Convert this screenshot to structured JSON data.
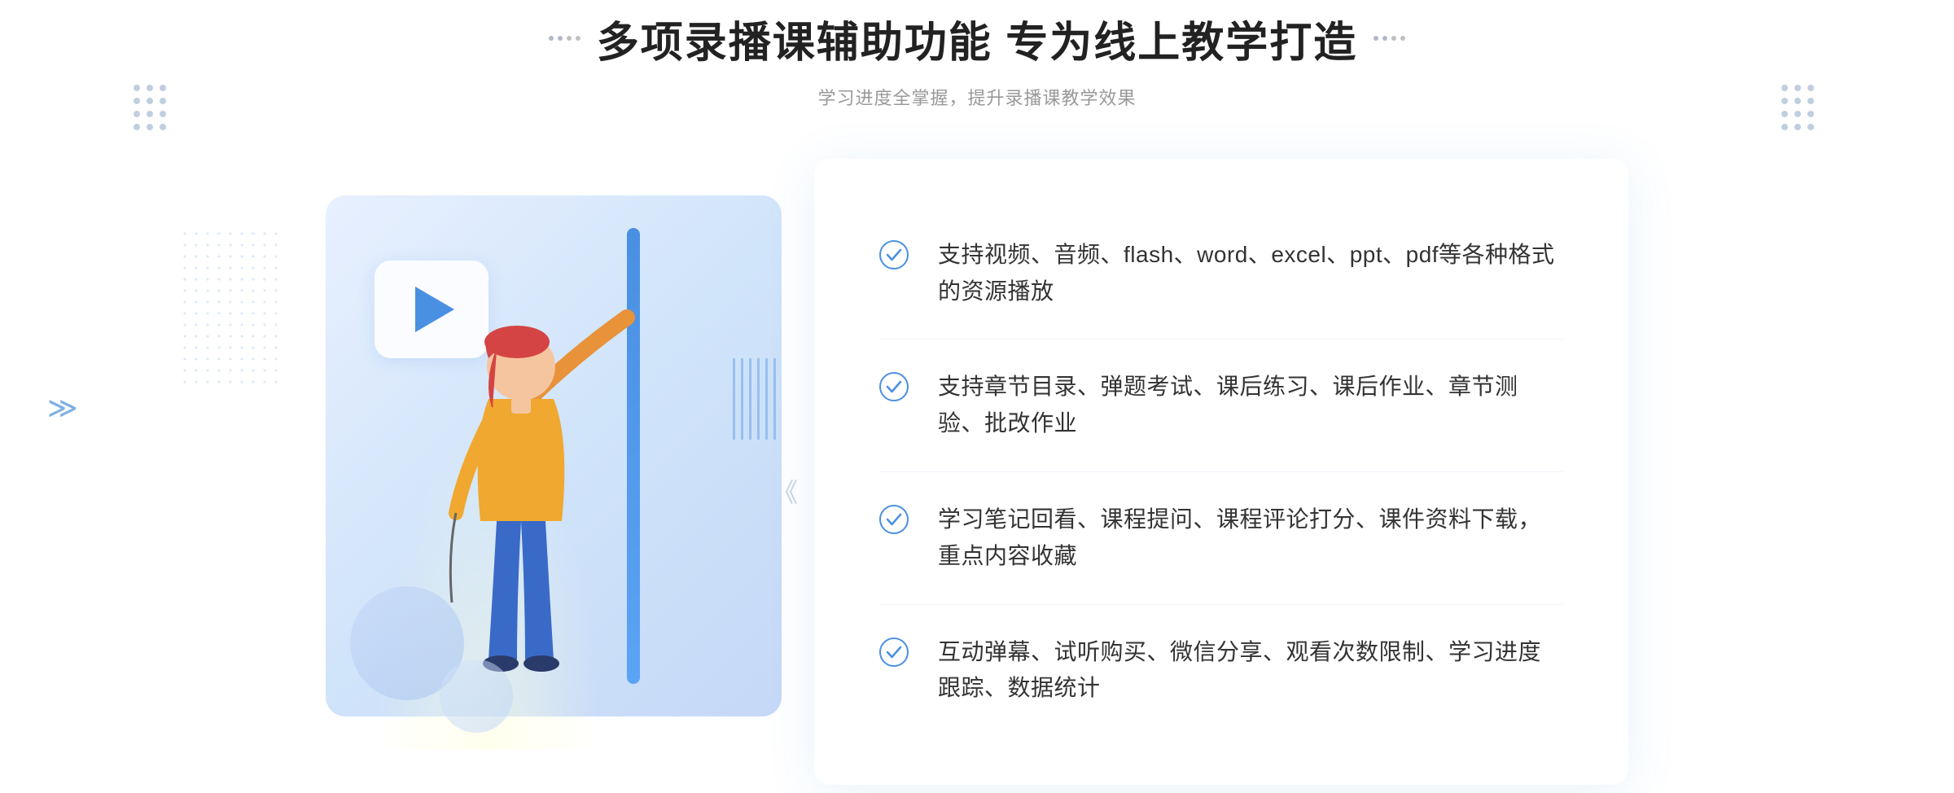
{
  "header": {
    "title": "多项录播课辅助功能 专为线上教学打造",
    "subtitle": "学习进度全掌握，提升录播课教学效果",
    "dots_label": "decorative dots"
  },
  "features": [
    {
      "id": 1,
      "text": "支持视频、音频、flash、word、excel、ppt、pdf等各种格式的资源播放"
    },
    {
      "id": 2,
      "text": "支持章节目录、弹题考试、课后练习、课后作业、章节测验、批改作业"
    },
    {
      "id": 3,
      "text": "学习笔记回看、课程提问、课程评论打分、课件资料下载，重点内容收藏"
    },
    {
      "id": 4,
      "text": "互动弹幕、试听购买、微信分享、观看次数限制、学习进度跟踪、数据统计"
    }
  ],
  "colors": {
    "primary_blue": "#4a90e2",
    "light_blue_bg": "#e8f0fe",
    "text_dark": "#222222",
    "text_gray": "#999999",
    "text_body": "#333333",
    "white": "#ffffff"
  },
  "icons": {
    "check": "check-circle-icon",
    "play": "play-icon",
    "arrow": "arrow-right-icon"
  }
}
